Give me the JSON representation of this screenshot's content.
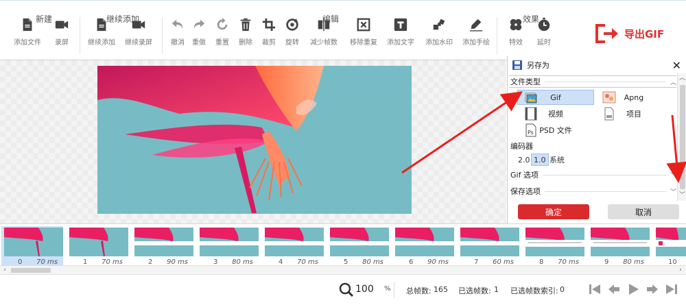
{
  "ribbon": {
    "groups": [
      {
        "title": "新建",
        "buttons": [
          {
            "label": "添加文件",
            "icon": "file-icon"
          },
          {
            "label": "录屏",
            "icon": "camera-icon"
          }
        ]
      },
      {
        "title": "继续添加",
        "buttons": [
          {
            "label": "继续添加",
            "icon": "file-add-icon"
          },
          {
            "label": "继续录屏",
            "icon": "camera-add-icon"
          }
        ]
      },
      {
        "title": "编辑",
        "buttons": [
          {
            "label": "撤消",
            "icon": "undo-icon"
          },
          {
            "label": "重做",
            "icon": "redo-icon"
          },
          {
            "label": "重置",
            "icon": "reset-icon"
          },
          {
            "label": "删除",
            "icon": "trash-icon"
          },
          {
            "label": "裁剪",
            "icon": "crop-icon"
          },
          {
            "label": "旋转",
            "icon": "rotate-icon"
          },
          {
            "label": "减少帧数",
            "icon": "reduce-frames-icon"
          },
          {
            "label": "移除重复",
            "icon": "remove-duplicates-icon"
          },
          {
            "label": "添加文字",
            "icon": "text-icon"
          },
          {
            "label": "添加水印",
            "icon": "watermark-icon"
          },
          {
            "label": "添加手绘",
            "icon": "draw-icon"
          }
        ]
      },
      {
        "title": "效果",
        "buttons": [
          {
            "label": "特效",
            "icon": "effects-icon"
          },
          {
            "label": "延时",
            "icon": "timer-icon"
          }
        ]
      }
    ],
    "export_label": "导出GIF"
  },
  "panel": {
    "title": "另存为",
    "file_type_section": "文件类型",
    "file_types": [
      {
        "name": "Gif",
        "selected": true
      },
      {
        "name": "Apng",
        "selected": false
      },
      {
        "name": "视频",
        "selected": false
      },
      {
        "name": "项目",
        "selected": false
      },
      {
        "name": "PSD 文件",
        "selected": false
      }
    ],
    "encoder_section": "编码器",
    "encoders": [
      {
        "name": "2.0",
        "selected": false
      },
      {
        "name": "1.0",
        "selected": true
      },
      {
        "name": "系统",
        "selected": false
      }
    ],
    "gif_options": "Gif 选项",
    "save_options": "保存选项",
    "ok_label": "确定",
    "cancel_label": "取消"
  },
  "frames": [
    {
      "index": "0",
      "duration": "70 ms"
    },
    {
      "index": "1",
      "duration": "70 ms"
    },
    {
      "index": "2",
      "duration": "90 ms"
    },
    {
      "index": "3",
      "duration": "80 ms"
    },
    {
      "index": "4",
      "duration": "70 ms"
    },
    {
      "index": "5",
      "duration": "80 ms"
    },
    {
      "index": "6",
      "duration": "90 ms"
    },
    {
      "index": "7",
      "duration": "60 ms"
    },
    {
      "index": "8",
      "duration": "70 ms"
    },
    {
      "index": "9",
      "duration": "80 ms"
    },
    {
      "index": "10",
      "duration": ""
    }
  ],
  "status": {
    "zoom": "100",
    "zoom_unit": "%",
    "total_frames_label": "总帧数:",
    "total_frames": "165",
    "selected_frames_label": "已选帧数:",
    "selected_frames": "1",
    "selected_index_label": "已选帧数索引:",
    "selected_index": "0"
  },
  "colors": {
    "accent_red": "#d92b2b",
    "selection_blue": "#cde0f7",
    "arrow_red": "#e8201c",
    "sky": "#77bcc4"
  }
}
